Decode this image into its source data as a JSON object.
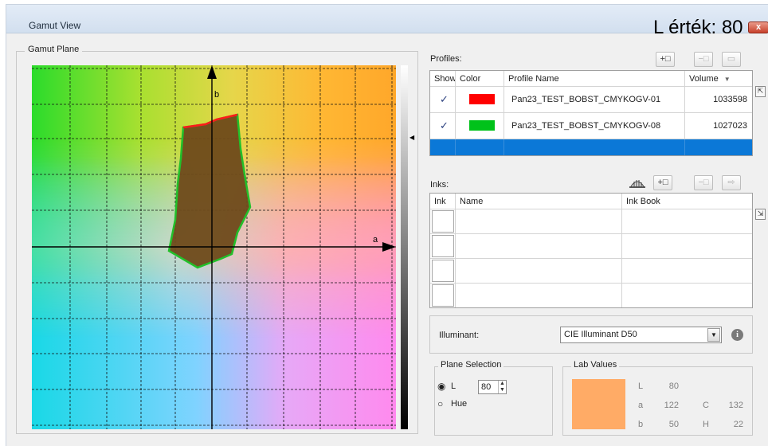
{
  "window": {
    "title": "Gamut View",
    "l_value_title": "L érték: 80",
    "close_label": "x"
  },
  "gamut_plane": {
    "legend": "Gamut Plane",
    "axis_b_label": "b",
    "axis_a_label": "a",
    "profile_colors": [
      "#ff1a1a",
      "#22c02a"
    ],
    "fill_color": "#6e4a1a"
  },
  "profiles": {
    "label": "Profiles:",
    "add_button": "+□",
    "remove_button": "−□",
    "compare_icon": "compare-icon",
    "columns": [
      "Show",
      "Color",
      "Profile Name",
      "Volume"
    ],
    "sort_indicator": "▼",
    "rows": [
      {
        "show": "✓",
        "color": "#ff0000",
        "name": "Pan23_TEST_BOBST_CMYKOGV-01",
        "volume": "1033598"
      },
      {
        "show": "✓",
        "color": "#00c21a",
        "name": "Pan23_TEST_BOBST_CMYKOGV-08",
        "volume": "1027023"
      }
    ],
    "selected_row_color": "#0b78d7"
  },
  "inks": {
    "label": "Inks:",
    "ink_book_icon": "ink-book-icon",
    "add_button": "+□",
    "remove_button": "−□",
    "move_icon": "move-icon",
    "columns": [
      "Ink",
      "Name",
      "Ink Book"
    ],
    "row_count": 4
  },
  "illuminant": {
    "label": "Illuminant:",
    "value": "CIE Illuminant D50",
    "info_icon": "info-icon"
  },
  "plane_selection": {
    "legend": "Plane Selection",
    "options": [
      "L",
      "Hue"
    ],
    "selected": "L",
    "l_value": "80"
  },
  "lab_values": {
    "legend": "Lab Values",
    "swatch_color": "#ffab66",
    "L_label": "L",
    "L": "80",
    "a_label": "a",
    "a": "122",
    "b_label": "b",
    "b": "50",
    "C_label": "C",
    "C": "132",
    "H_label": "H",
    "H": "22"
  }
}
